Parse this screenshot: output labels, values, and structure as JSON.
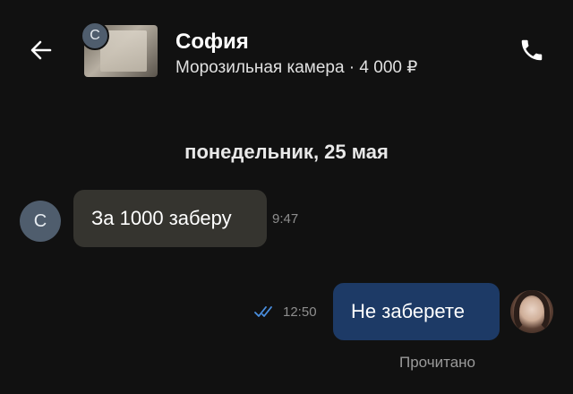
{
  "header": {
    "contact_name": "София",
    "contact_initial": "С",
    "listing_info": "Морозильная камера · 4 000 ₽",
    "back_icon": "arrow-left-icon",
    "call_icon": "phone-icon"
  },
  "chat": {
    "date_separator": "понедельник, 25 мая",
    "messages": [
      {
        "direction": "incoming",
        "sender_initial": "С",
        "text": "За 1000 заберу",
        "time": "9:47"
      },
      {
        "direction": "outgoing",
        "text": "Не заберете",
        "time": "12:50",
        "status_icon": "double-check-icon"
      }
    ],
    "read_status": "Прочитано"
  },
  "colors": {
    "background": "#111111",
    "incoming_bubble": "#35342f",
    "outgoing_bubble": "#1d3a66",
    "avatar_bg": "#4f5d6d",
    "check_blue": "#4a8fe0",
    "muted_text": "#8e8e8e"
  }
}
